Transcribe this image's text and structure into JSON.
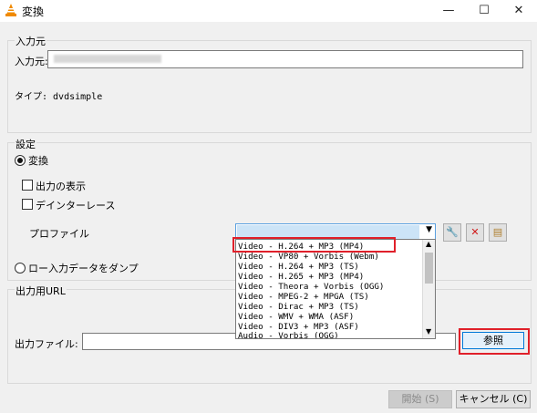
{
  "window": {
    "title": "変換",
    "minimize": "—",
    "maximize": "☐",
    "close": "✕"
  },
  "source": {
    "group_title": "入力元",
    "input_label": "入力元:",
    "input_value": "",
    "type_label": "タイプ: dvdsimple"
  },
  "settings": {
    "group_title": "設定",
    "convert_label": "変換",
    "show_output_label": "出力の表示",
    "deinterlace_label": "デインターレース",
    "profile_label": "プロファイル",
    "dump_label": "ロー入力データをダンプ"
  },
  "profile_options": [
    "Video - H.264 + MP3 (MP4)",
    "Video - VP80 + Vorbis (Webm)",
    "Video - H.264 + MP3 (TS)",
    "Video - H.265 + MP3 (MP4)",
    "Video - Theora + Vorbis (OGG)",
    "Video - MPEG-2 + MPGA (TS)",
    "Video - Dirac + MP3 (TS)",
    "Video - WMV + WMA (ASF)",
    "Video - DIV3 + MP3 (ASF)",
    "Audio - Vorbis (OGG)"
  ],
  "destination": {
    "group_title": "出力用URL",
    "file_label": "出力ファイル:",
    "file_value": "",
    "browse_label": "参照"
  },
  "footer": {
    "start_label": "開始 (S)",
    "cancel_label": "キャンセル (C)"
  },
  "colors": {
    "highlight": "#e0202a",
    "vlc_orange": "#f08a00"
  }
}
